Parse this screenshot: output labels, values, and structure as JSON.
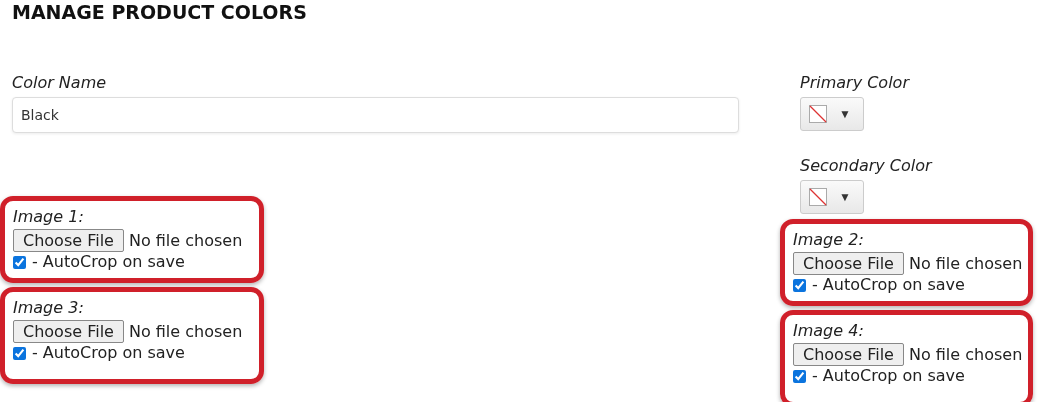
{
  "title": "MANAGE PRODUCT COLORS",
  "color_name": {
    "label": "Color Name",
    "value": "Black"
  },
  "primary_color": {
    "label": "Primary Color",
    "arrow": "▼"
  },
  "secondary_color": {
    "label": "Secondary Color",
    "arrow": "▼"
  },
  "images": [
    {
      "label": "Image 1:",
      "button": "Choose File",
      "status": "No file chosen",
      "autocrop_label": "- AutoCrop on save",
      "checked": true,
      "highlighted": true
    },
    {
      "label": "Image 2:",
      "button": "Choose File",
      "status": "No file chosen",
      "autocrop_label": "- AutoCrop on save",
      "checked": true,
      "highlighted": true
    },
    {
      "label": "Image 3:",
      "button": "Choose File",
      "status": "No file chosen",
      "autocrop_label": "- AutoCrop on save",
      "checked": true,
      "highlighted": true
    },
    {
      "label": "Image 4:",
      "button": "Choose File",
      "status": "No file chosen",
      "autocrop_label": "- AutoCrop on save",
      "checked": true,
      "highlighted": true
    }
  ]
}
